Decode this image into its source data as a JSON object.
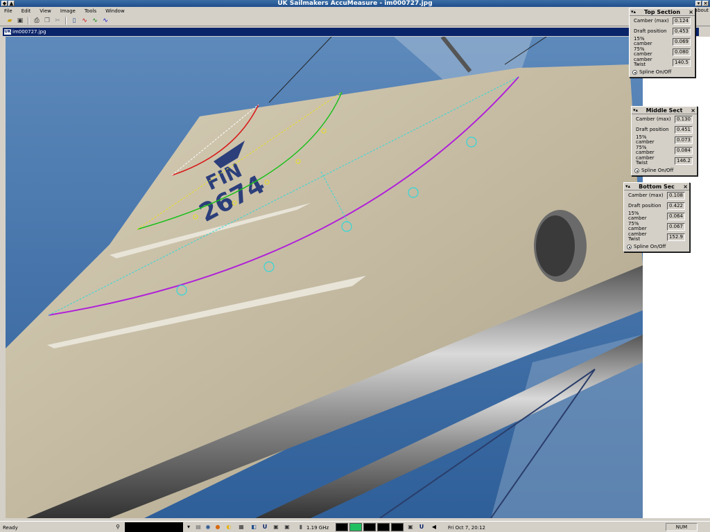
{
  "window": {
    "title": "UK Sailmakers AccuMeasure - im000727.jpg",
    "doc_title": "im000727.jpg",
    "about": "about"
  },
  "menu": [
    "File",
    "Edit",
    "View",
    "Image",
    "Tools",
    "Window"
  ],
  "panels": [
    {
      "title": "Top Section",
      "camber_max": "0.124",
      "draft_position": "0.453",
      "camber15": "0.069",
      "camber75": "0.080",
      "twist": "140.5",
      "spline": "Spline On/Off"
    },
    {
      "title": "Middle Sect",
      "camber_max": "0.130",
      "draft_position": "0.451",
      "camber15": "0.073",
      "camber75": "0.084",
      "twist": "146.2",
      "spline": "Spline On/Off"
    },
    {
      "title": "Bottom Sec",
      "camber_max": "0.108",
      "draft_position": "0.422",
      "camber15": "0.064",
      "camber75": "0.067",
      "twist": "152.9",
      "spline": "Spline On/Off"
    }
  ],
  "labels": {
    "camber_max": "Camber (max)",
    "draft_position": "Draft position",
    "camber15_a": "15%",
    "camber15_b": "camber",
    "camber75_a": "75%",
    "camber75_b": "camber",
    "twist_a": "camber",
    "twist_b": "Twist"
  },
  "sail": {
    "number": "2674",
    "country": "FIN"
  },
  "status": {
    "ready": "Ready",
    "cpu": "1.19 GHz",
    "clock": "Fri Oct  7, 20:12",
    "num": "NUM"
  },
  "colors": {
    "sky": "#3d6fa8",
    "sail": "#c9c0a8",
    "spar": "#8a8a8a",
    "title_bar": "#1f4e8c"
  }
}
